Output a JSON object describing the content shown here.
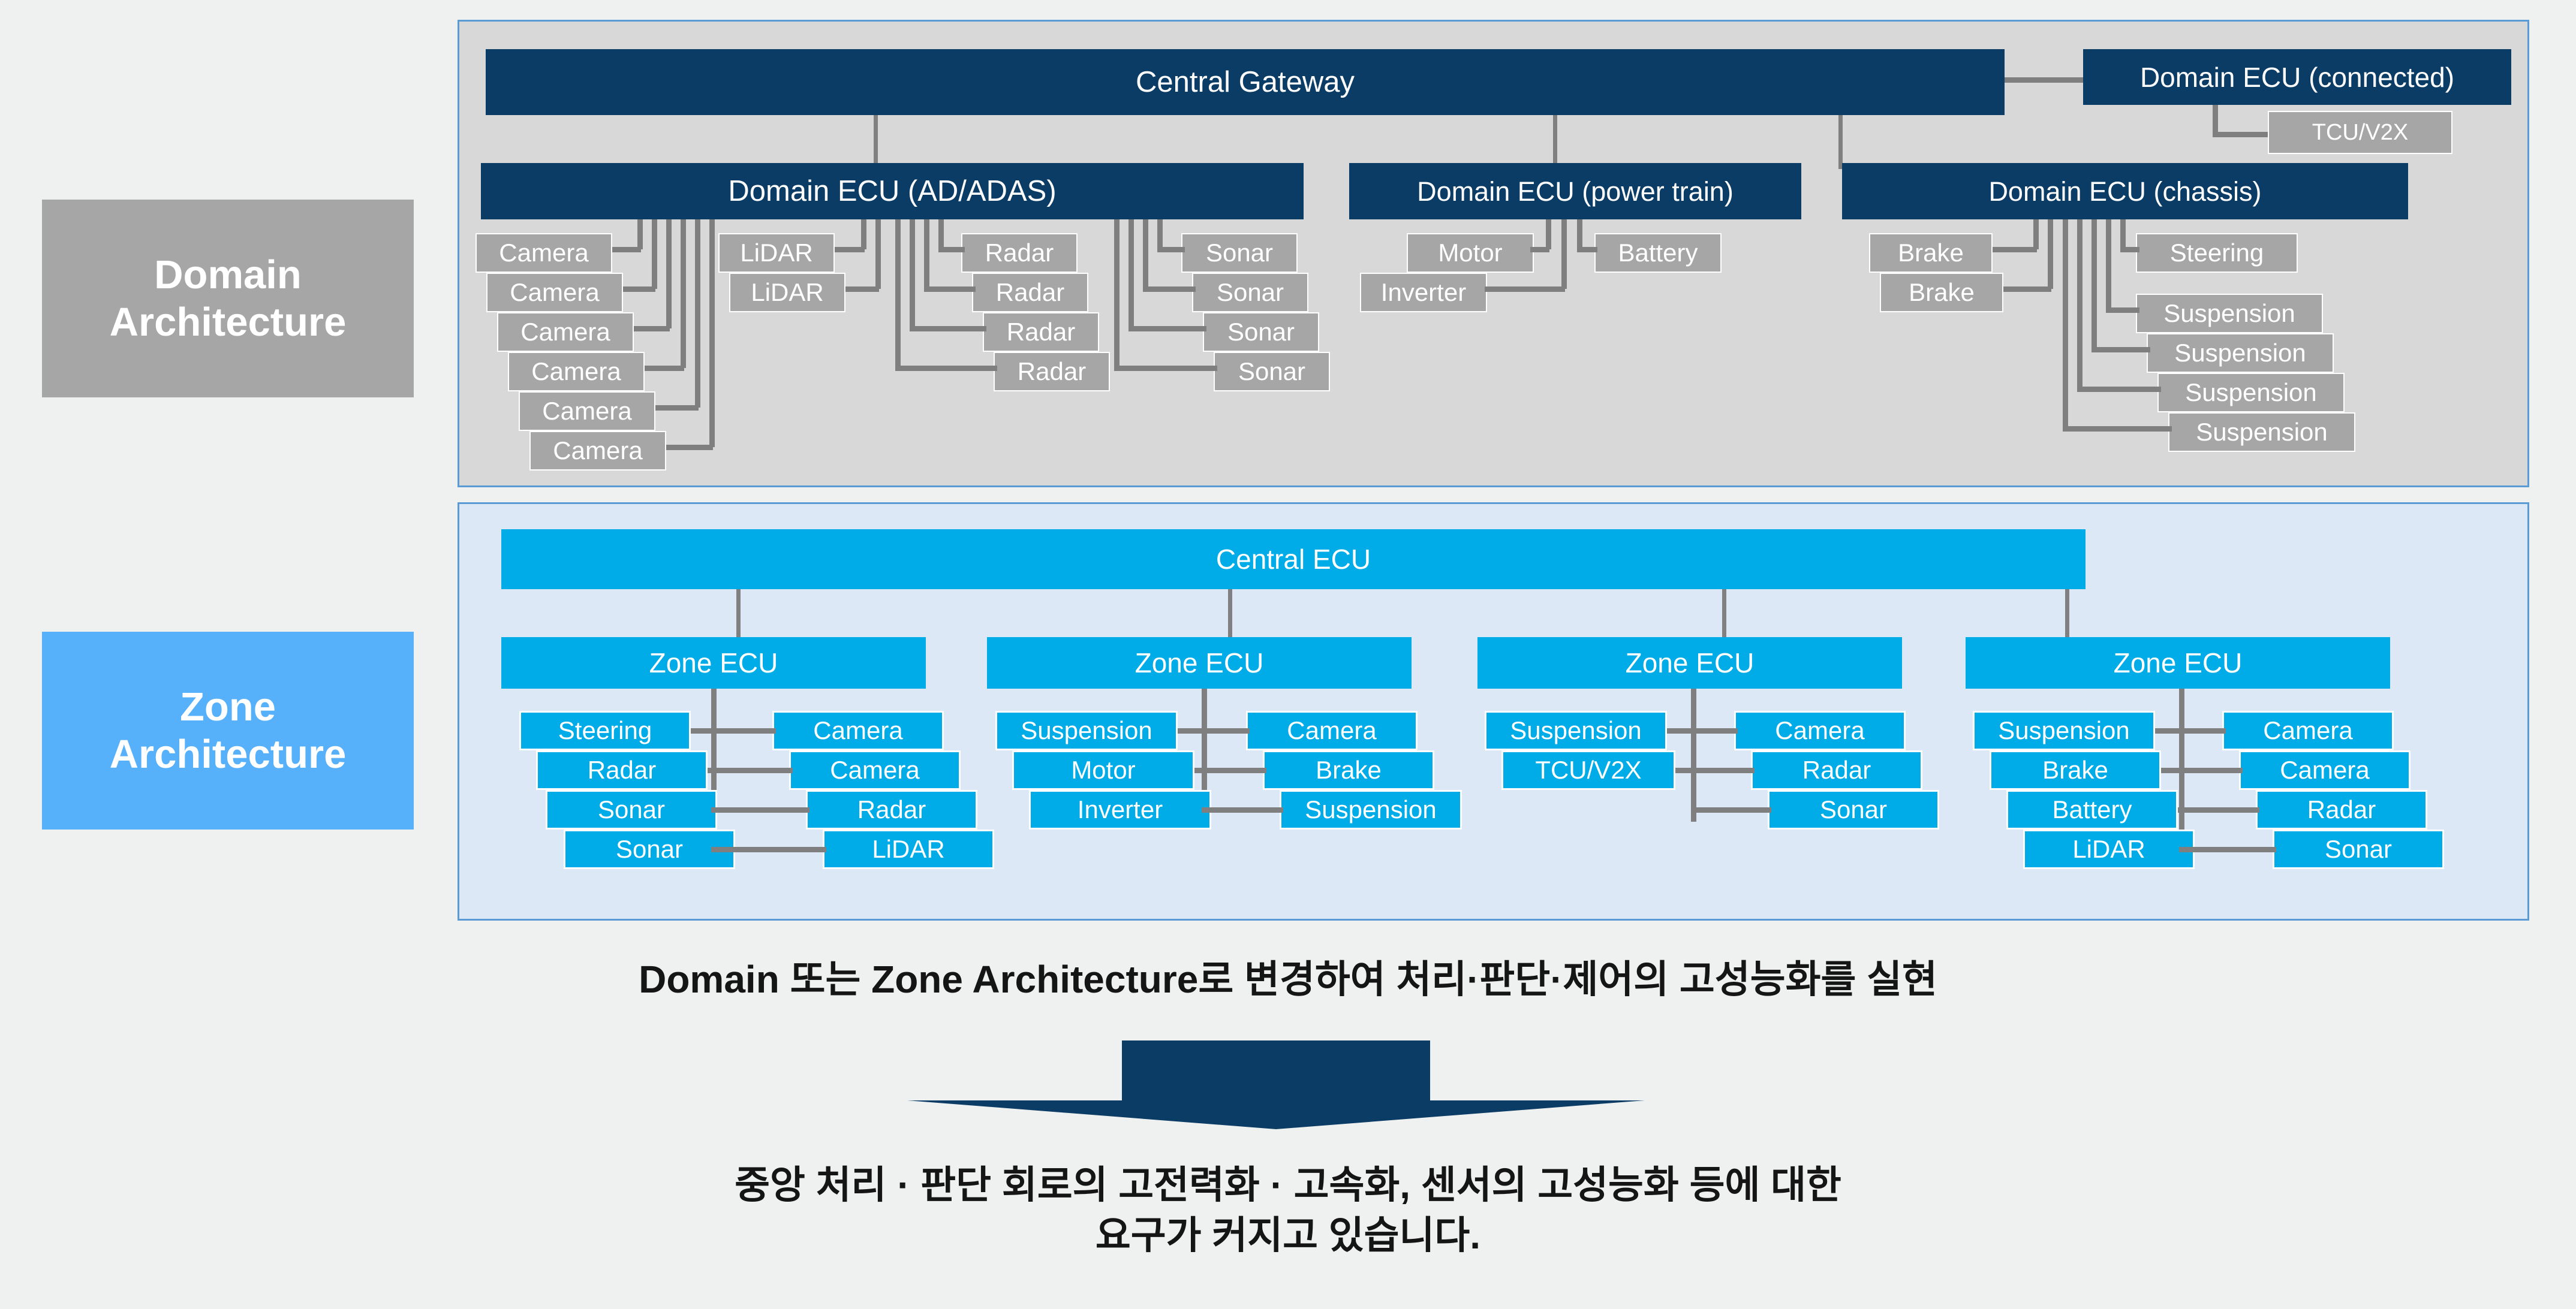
{
  "colors": {
    "page_bg": "#eff1f1",
    "domain_panel_bg": "#d8d8d8",
    "zone_panel_bg": "#dde8f6",
    "panel_border": "#5b9bd5",
    "ecu_dark": "#0b3c65",
    "leaf_gray": "#a6a6a6",
    "zone_blue": "#00ace8",
    "side_zone_bg": "#57b0fa",
    "connector": "#808080",
    "arrow": "#0b3c65",
    "text_light": "#ffffff",
    "text_dark": "#151515"
  },
  "sidebar": {
    "domain_label": "Domain\nArchitecture",
    "zone_label": "Zone\nArchitecture"
  },
  "domain": {
    "central_gateway": "Central Gateway",
    "connected_ecu": "Domain ECU (connected)",
    "connected_leaf": "TCU/V2X",
    "groups": [
      {
        "ecu": "Domain ECU (AD/ADAS)",
        "left_leaves": [
          "Camera",
          "Camera",
          "Camera",
          "Camera",
          "Camera",
          "Camera"
        ],
        "mid_leaves": [
          "LiDAR",
          "LiDAR"
        ],
        "right_leaves": [
          "Radar",
          "Radar",
          "Radar",
          "Radar"
        ],
        "far_leaves": [
          "Sonar",
          "Sonar",
          "Sonar",
          "Sonar"
        ]
      },
      {
        "ecu": "Domain ECU (power train)",
        "left_leaves": [
          "Motor",
          "Inverter"
        ],
        "right_leaves": [
          "Battery"
        ]
      },
      {
        "ecu": "Domain ECU (chassis)",
        "left_leaves": [
          "Brake",
          "Brake"
        ],
        "right_leaves": [
          "Steering",
          "Suspension",
          "Suspension",
          "Suspension",
          "Suspension"
        ]
      }
    ]
  },
  "zone": {
    "central_ecu": "Central ECU",
    "zones": [
      {
        "ecu": "Zone ECU",
        "left_leaves": [
          "Steering",
          "Radar",
          "Sonar",
          "Sonar"
        ],
        "right_leaves": [
          "Camera",
          "Camera",
          "Radar",
          "LiDAR"
        ]
      },
      {
        "ecu": "Zone ECU",
        "left_leaves": [
          "Suspension",
          "Motor",
          "Inverter"
        ],
        "right_leaves": [
          "Camera",
          "Brake",
          "Suspension"
        ]
      },
      {
        "ecu": "Zone ECU",
        "left_leaves": [
          "Suspension",
          "TCU/V2X"
        ],
        "right_leaves": [
          "Camera",
          "Radar",
          "Sonar"
        ]
      },
      {
        "ecu": "Zone ECU",
        "left_leaves": [
          "Suspension",
          "Brake",
          "Battery",
          "LiDAR"
        ],
        "right_leaves": [
          "Camera",
          "Camera",
          "Radar",
          "Sonar"
        ]
      }
    ]
  },
  "captions": {
    "top": "Domain 또는 Zone Architecture로 변경하여 처리·판단·제어의 고성능화를 실현",
    "bottom": "중앙 처리 · 판단 회로의 고전력화 · 고속화, 센서의 고성능화 등에 대한\n요구가 커지고 있습니다."
  }
}
